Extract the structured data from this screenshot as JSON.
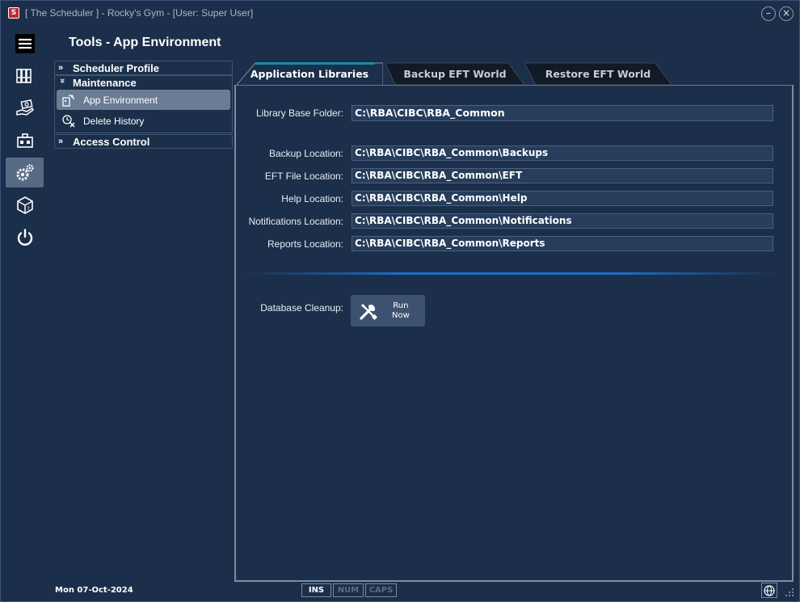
{
  "window": {
    "title": "[ The Scheduler ] - Rocky's Gym - [User: Super User]",
    "logo_letter": "S",
    "minimize_label": "–",
    "close_label": "×"
  },
  "rail": {
    "items": [
      {
        "icon": "menu-icon"
      },
      {
        "icon": "binders-icon"
      },
      {
        "icon": "payment-hand-icon"
      },
      {
        "icon": "briefcase-icon"
      },
      {
        "icon": "gears-icon",
        "active": true
      },
      {
        "icon": "package-icon"
      },
      {
        "icon": "power-icon"
      }
    ]
  },
  "page": {
    "title": "Tools - App Environment"
  },
  "nav": {
    "groups": [
      {
        "label": "Scheduler Profile",
        "expanded": false
      },
      {
        "label": "Maintenance",
        "expanded": true,
        "items": [
          {
            "label": "App Environment",
            "selected": true,
            "icon": "app-environment-icon"
          },
          {
            "label": "Delete History",
            "icon": "delete-history-icon"
          }
        ]
      },
      {
        "label": "Access Control",
        "expanded": false
      }
    ]
  },
  "tabs": [
    {
      "label": "Application Libraries",
      "active": true
    },
    {
      "label": "Backup EFT World"
    },
    {
      "label": "Restore EFT World"
    }
  ],
  "form": {
    "library_base_folder": {
      "label": "Library Base Folder:",
      "value": "C:\\RBA\\CIBC\\RBA_Common"
    },
    "backup_location": {
      "label": "Backup Location:",
      "value": "C:\\RBA\\CIBC\\RBA_Common\\Backups"
    },
    "eft_file_location": {
      "label": "EFT File Location:",
      "value": "C:\\RBA\\CIBC\\RBA_Common\\EFT"
    },
    "help_location": {
      "label": "Help Location:",
      "value": "C:\\RBA\\CIBC\\RBA_Common\\Help"
    },
    "notifications_location": {
      "label": "Notifications Location:",
      "value": "C:\\RBA\\CIBC\\RBA_Common\\Notifications"
    },
    "reports_location": {
      "label": "Reports Location:",
      "value": "C:\\RBA\\CIBC\\RBA_Common\\Reports"
    },
    "database_cleanup": {
      "label": "Database Cleanup:",
      "button_line1": "Run",
      "button_line2": "Now"
    }
  },
  "status": {
    "date": "Mon  07-Oct-2024",
    "ins": "INS",
    "num": "NUM",
    "caps": "CAPS"
  },
  "colors": {
    "background": "#1b2f4a",
    "accent": "#1e6fc4",
    "tab_active_top": "#1e8aa8",
    "selected": "#6a7d95"
  }
}
